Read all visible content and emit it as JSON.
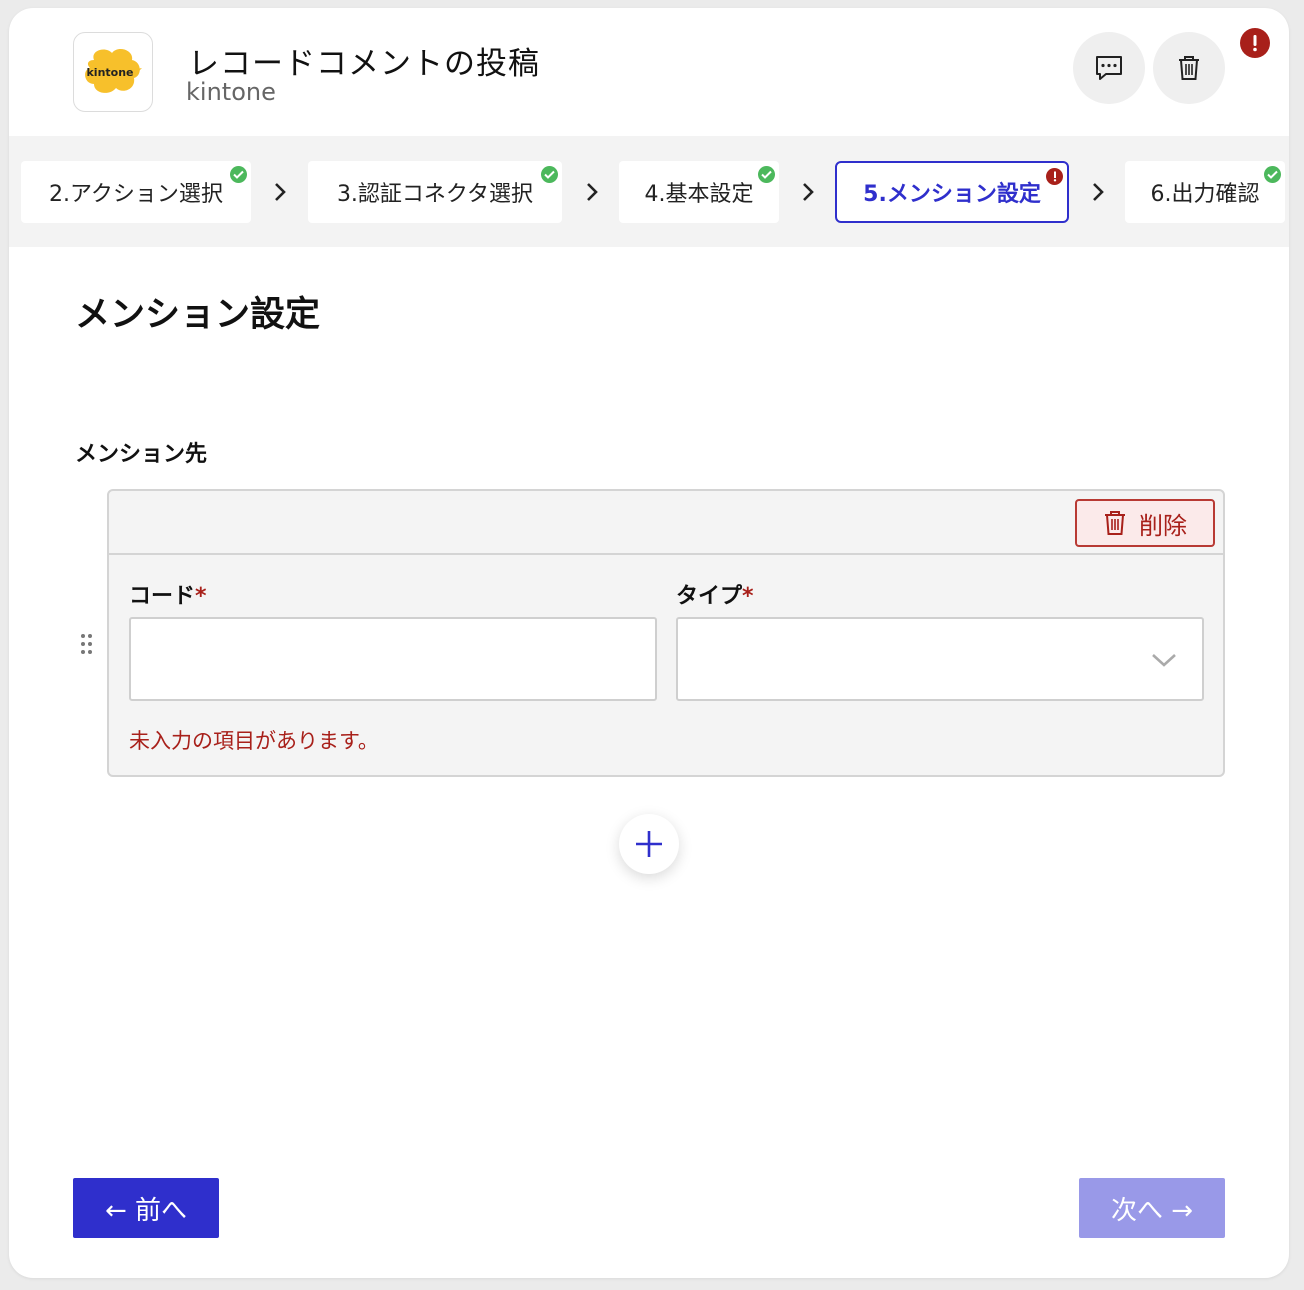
{
  "header": {
    "logo_text": "kintone",
    "title": "レコードコメントの投稿",
    "subtitle": "kintone",
    "comment_icon": "comment-icon",
    "delete_icon": "trash-icon",
    "alert_icon": "exclamation-icon"
  },
  "steps": [
    {
      "label": "2.アクション選択",
      "status": "ok"
    },
    {
      "label": "3.認証コネクタ選択",
      "status": "ok"
    },
    {
      "label": "4.基本設定",
      "status": "ok"
    },
    {
      "label": "5.メンション設定",
      "status": "error",
      "active": true
    },
    {
      "label": "6.出力確認",
      "status": "ok"
    }
  ],
  "page": {
    "heading": "メンション設定",
    "section_label": "メンション先"
  },
  "mention_item": {
    "delete_label": "削除",
    "code_label": "コード",
    "type_label": "タイプ",
    "required_mark": "*",
    "code_value": "",
    "type_value": "",
    "error_message": "未入力の項目があります。"
  },
  "footer": {
    "prev_label": "← 前へ",
    "next_label": "次へ →"
  },
  "colors": {
    "accent": "#2f2fcc",
    "accent_disabled": "#9999e8",
    "error": "#a8201a",
    "success": "#4cb85c"
  }
}
